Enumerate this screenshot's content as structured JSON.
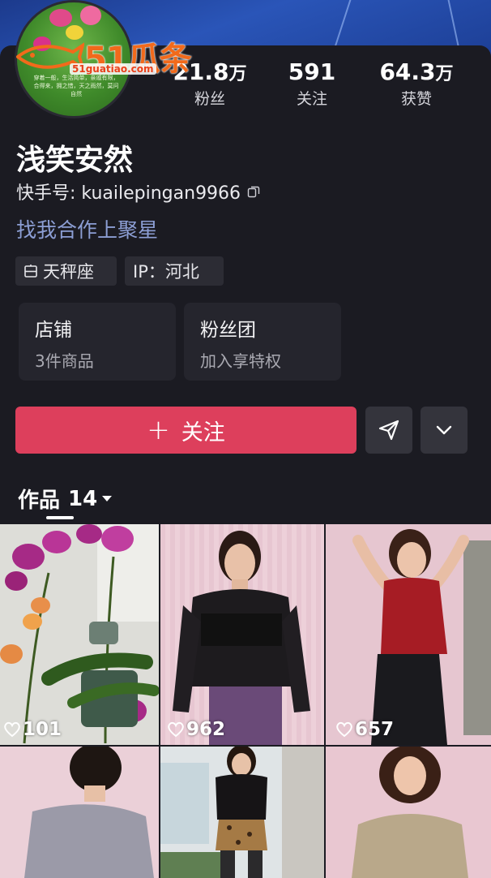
{
  "watermark": {
    "brand": "51瓜条",
    "url": "51guatiao.com"
  },
  "avatar": {
    "caption": "穿着一般，生活简单，亲戚有限，合得来，拥之惜，天之雨然，莫问自然"
  },
  "stats": [
    {
      "value": "21.8",
      "unit": "万",
      "label": "粉丝"
    },
    {
      "value": "591",
      "unit": "",
      "label": "关注"
    },
    {
      "value": "64.3",
      "unit": "万",
      "label": "获赞"
    }
  ],
  "profile": {
    "name": "浅笑安然",
    "kuaishou_id": "快手号: kuailepingan9966",
    "collab_link": "找我合作上聚星"
  },
  "tags": [
    {
      "icon": "zodiac-icon",
      "label": "天秤座"
    },
    {
      "icon": "",
      "label": "IP：河北"
    }
  ],
  "tiles": [
    {
      "title": "店铺",
      "subtitle": "3件商品"
    },
    {
      "title": "粉丝团",
      "subtitle": "加入享特权"
    }
  ],
  "actions": {
    "follow_label": "关注",
    "share_icon": "send-icon",
    "more_icon": "chevron-down-icon"
  },
  "works": {
    "label": "作品",
    "count": "14"
  },
  "grid": [
    {
      "likes": "101",
      "theme": "orchid"
    },
    {
      "likes": "962",
      "theme": "lace-top"
    },
    {
      "likes": "657",
      "theme": "red-top"
    },
    {
      "likes": "",
      "theme": "grey-top"
    },
    {
      "likes": "",
      "theme": "black-leopard"
    },
    {
      "likes": "",
      "theme": "beige-top"
    }
  ],
  "colors": {
    "accent": "#dd3f5c",
    "background": "#1b1b22",
    "link": "#8c9ed4"
  }
}
